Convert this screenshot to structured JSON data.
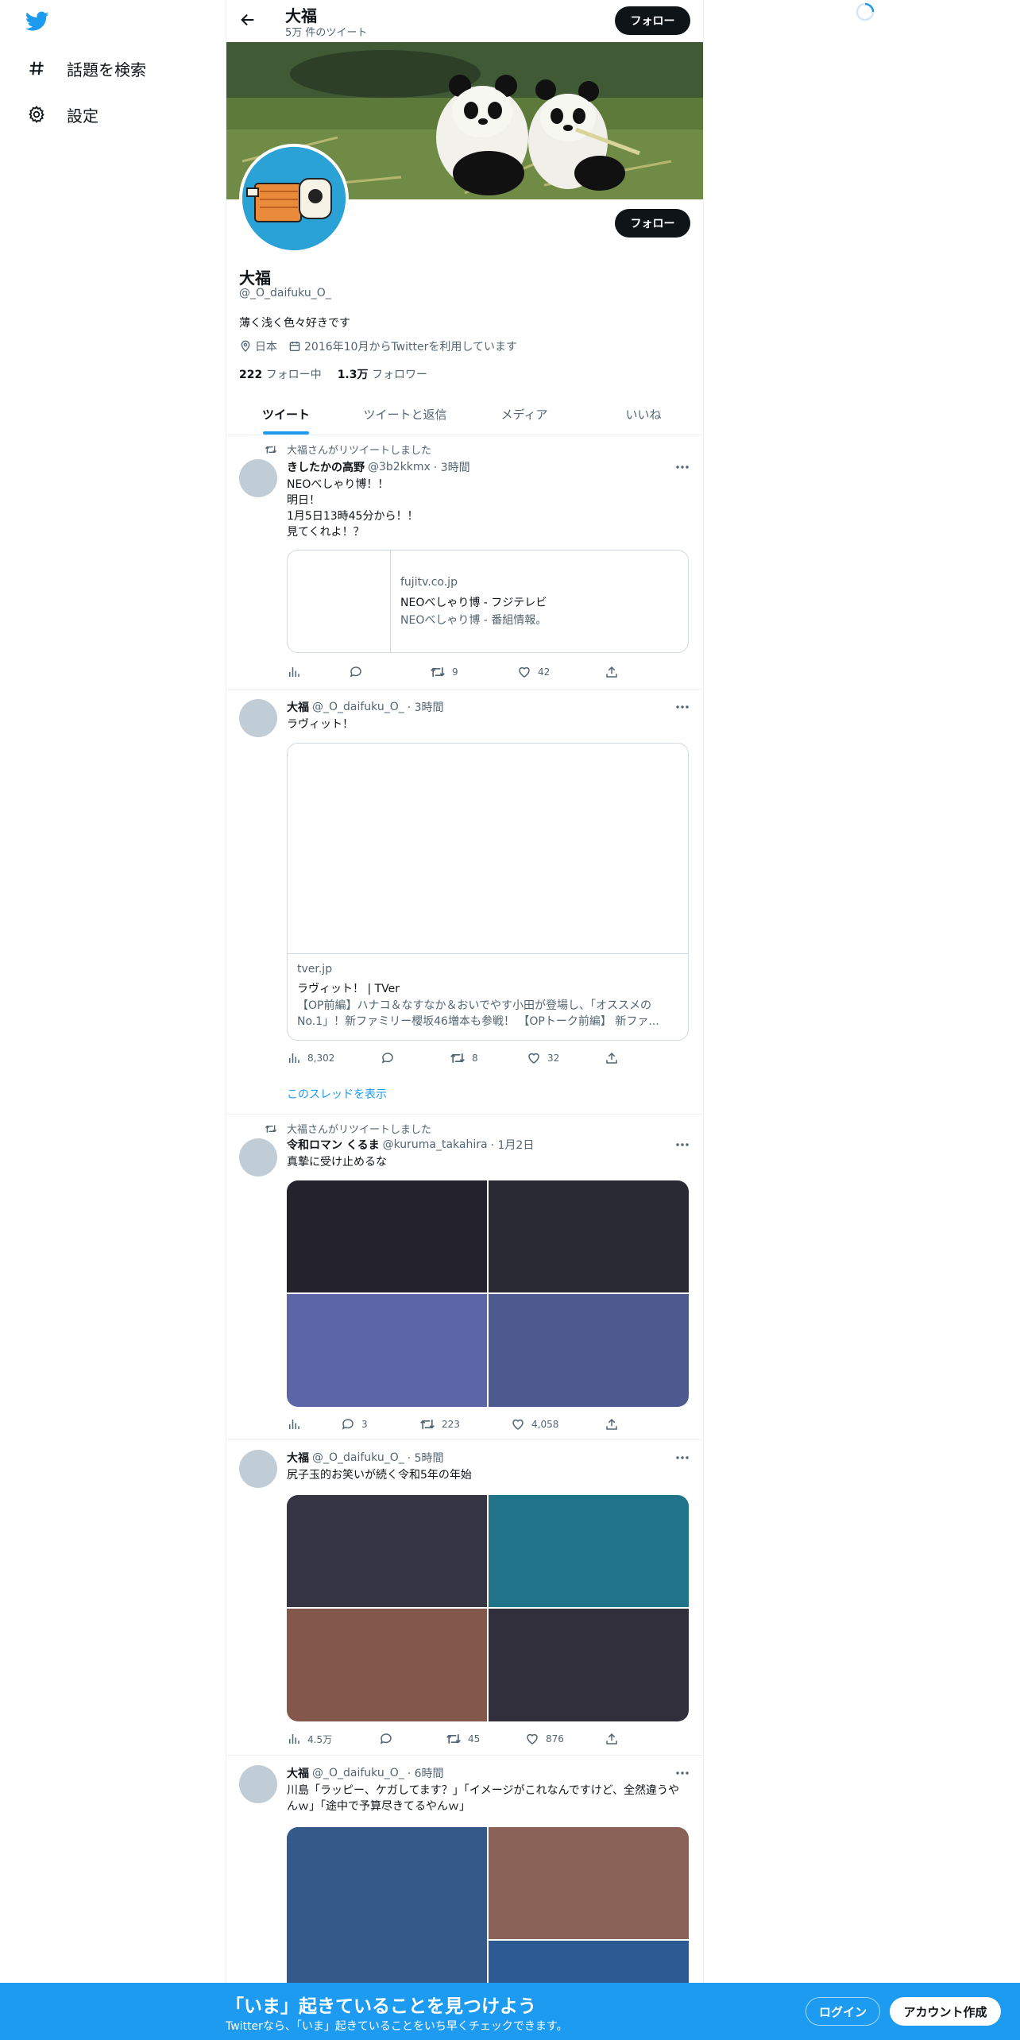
{
  "nav": {
    "explore_label": "話題を検索",
    "settings_label": "設定"
  },
  "header": {
    "name": "大福",
    "tweet_count": "5万 件のツイート",
    "follow_label": "フォロー"
  },
  "profile": {
    "name": "大福",
    "handle": "@_O_daifuku_O_",
    "bio": "薄く浅く色々好きです",
    "location": "日本",
    "joined": "2016年10月からTwitterを利用しています",
    "following_count": "222",
    "following_label": "フォロー中",
    "followers_count": "1.3万",
    "followers_label": "フォロワー",
    "follow_label": "フォロー"
  },
  "tabs": [
    "ツイート",
    "ツイートと返信",
    "メディア",
    "いいね"
  ],
  "tweets": [
    {
      "retweet_label": "大福さんがリツイートしました",
      "name": "きしたかの高野",
      "handle": "@3b2kkmx",
      "time": "· 3時間",
      "text": "NEOべしゃり博！！\n明日！\n1月5日13時45分から！！\n見てくれよ！？",
      "card": {
        "domain": "fujitv.co.jp",
        "title": "NEOべしゃり博 - フジテレビ",
        "desc": "NEOべしゃり博 - 番組情報。"
      },
      "stats": {
        "views": "",
        "replies": "",
        "retweets": "9",
        "likes": "42"
      }
    },
    {
      "name": "大福",
      "handle": "@_O_daifuku_O_",
      "time": "· 3時間",
      "text": "ラヴィット！",
      "card": {
        "domain": "tver.jp",
        "title": "ラヴィット！ | TVer",
        "desc": "【OP前編】ハナコ＆なすなか＆おいでやす小田が登場し、「オススメのNo.1」！新ファミリー櫻坂46増本も参戦！ 【OPトーク前編】 新ファ..."
      },
      "stats": {
        "views": "8,302",
        "replies": "",
        "retweets": "8",
        "likes": "32"
      },
      "thread_label": "このスレッドを表示"
    },
    {
      "retweet_label": "大福さんがリツイートしました",
      "name": "令和ロマン くるま",
      "handle": "@kuruma_takahira",
      "time": "· 1月2日",
      "text": "真摯に受け止めるな",
      "stats": {
        "views": "",
        "replies": "3",
        "retweets": "223",
        "likes": "4,058"
      }
    },
    {
      "name": "大福",
      "handle": "@_O_daifuku_O_",
      "time": "· 5時間",
      "text": "尻子玉的お笑いが続く令和5年の年始",
      "stats": {
        "views": "4.5万",
        "replies": "",
        "retweets": "45",
        "likes": "876"
      }
    },
    {
      "name": "大福",
      "handle": "@_O_daifuku_O_",
      "time": "· 6時間",
      "text": "川島「ラッピー、ケガしてます？」「イメージがこれなんですけど、全然違うやんｗ」「途中で予算尽きてるやんｗ」"
    }
  ],
  "media_colors": {
    "t3": [
      "#24232d",
      "#2a2a35",
      "#5c65a6",
      "#4d5a8f"
    ],
    "t4": [
      "#363544",
      "#217389",
      "#83584b",
      "#302f3b"
    ],
    "t5": [
      "#345a89",
      "#8a6258",
      "#2d5a93"
    ]
  },
  "bottom": {
    "title": "「いま」起きていることを見つけよう",
    "subtitle": "Twitterなら、「いま」起きていることをいち早くチェックできます。",
    "login_label": "ログイン",
    "signup_label": "アカウント作成"
  },
  "colors": {
    "accent": "#1d9bf0",
    "text": "#0f1419",
    "muted": "#536471"
  }
}
